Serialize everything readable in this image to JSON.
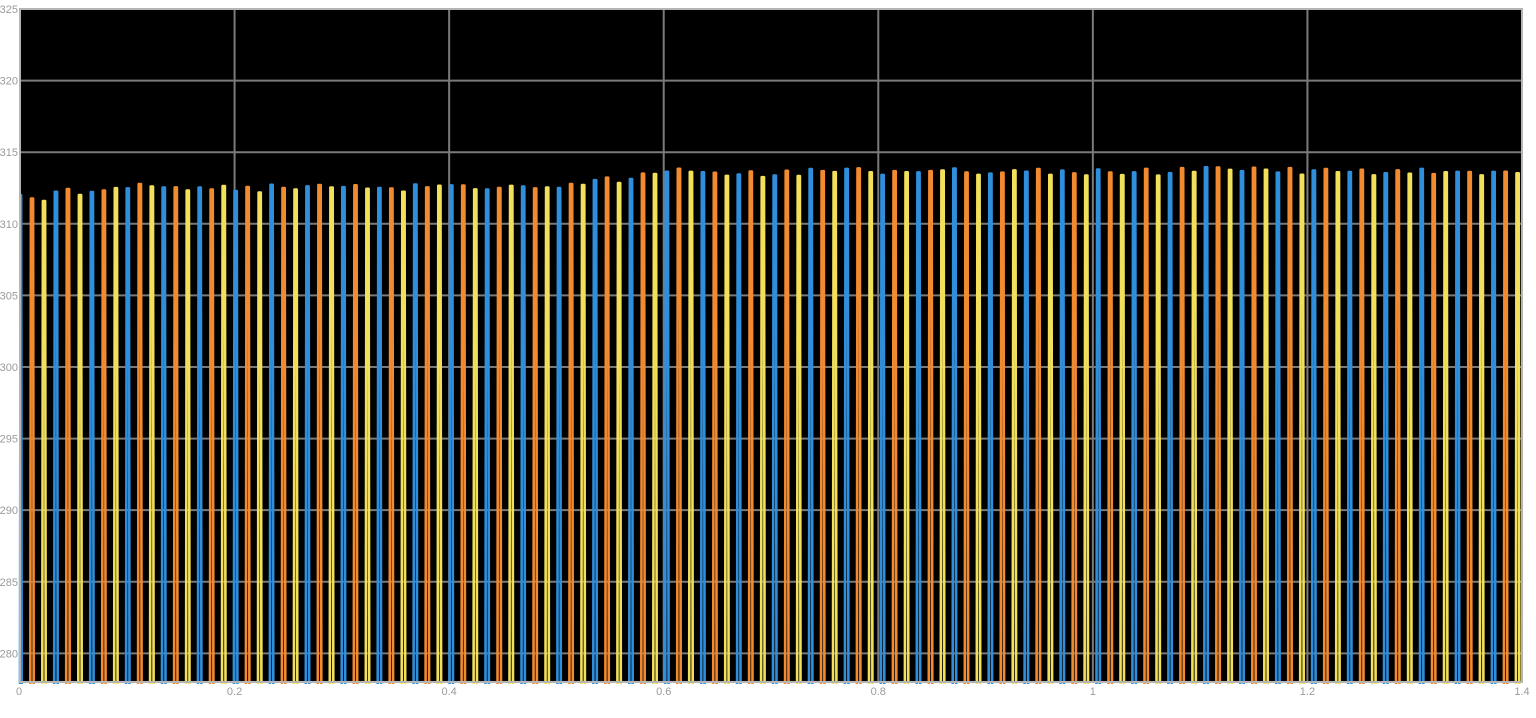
{
  "chart_data": {
    "type": "line",
    "title": "",
    "xlabel": "",
    "ylabel": "",
    "xlim": [
      0,
      1.4
    ],
    "ylim": [
      278,
      325
    ],
    "grid": true,
    "background": "#000000",
    "grid_color": "#7a7a7a",
    "xticks": [
      "0",
      "0.2",
      "0.4",
      "0.6",
      "0.8",
      "1",
      "1.2",
      "1.4"
    ],
    "yticks": [
      "280",
      "285",
      "290",
      "295",
      "300",
      "305",
      "310",
      "315",
      "320",
      "325"
    ],
    "pulse_period": 0.0335,
    "series": [
      {
        "color": "#2f8fdc",
        "phase": 0.0,
        "peak_points": [
          [
            0.0,
            312.0
          ],
          [
            0.1,
            312.6
          ],
          [
            0.2,
            312.5
          ],
          [
            0.3,
            312.6
          ],
          [
            0.4,
            312.6
          ],
          [
            0.5,
            312.6
          ],
          [
            0.6,
            313.6
          ],
          [
            0.7,
            313.6
          ],
          [
            0.8,
            313.6
          ],
          [
            1.0,
            313.7
          ],
          [
            1.2,
            313.7
          ],
          [
            1.4,
            313.7
          ]
        ]
      },
      {
        "color": "#f28a30",
        "phase": 0.0112,
        "peak_points": [
          [
            0.0,
            311.9
          ],
          [
            0.1,
            312.6
          ],
          [
            0.2,
            312.5
          ],
          [
            0.3,
            312.6
          ],
          [
            0.4,
            312.7
          ],
          [
            0.5,
            312.7
          ],
          [
            0.6,
            313.6
          ],
          [
            0.7,
            313.7
          ],
          [
            0.8,
            313.7
          ],
          [
            1.0,
            313.7
          ],
          [
            1.2,
            313.7
          ],
          [
            1.4,
            313.7
          ]
        ]
      },
      {
        "color": "#f2e05a",
        "phase": 0.0224,
        "peak_points": [
          [
            0.0,
            311.5
          ],
          [
            0.1,
            312.5
          ],
          [
            0.2,
            312.4
          ],
          [
            0.3,
            312.5
          ],
          [
            0.4,
            312.4
          ],
          [
            0.5,
            312.5
          ],
          [
            0.6,
            313.4
          ],
          [
            0.7,
            313.5
          ],
          [
            0.8,
            313.5
          ],
          [
            1.0,
            313.6
          ],
          [
            1.2,
            313.6
          ],
          [
            1.4,
            313.6
          ]
        ]
      }
    ]
  }
}
